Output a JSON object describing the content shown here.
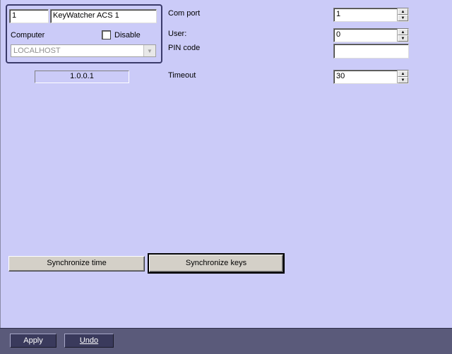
{
  "device": {
    "id": "1",
    "name": "KeyWatcher ACS 1",
    "computer_label": "Computer",
    "disable_label": "Disable",
    "computer_value": "LOCALHOST",
    "version": "1.0.0.1"
  },
  "settings": {
    "com_port_label": "Com port",
    "com_port_value": "1",
    "user_label": "User:",
    "user_value": "0",
    "pin_label": "PIN code",
    "pin_value": "",
    "timeout_label": "Timeout",
    "timeout_value": "30"
  },
  "actions": {
    "sync_time": "Synchronize time",
    "sync_keys": "Synchronize keys"
  },
  "footer": {
    "apply": "Apply",
    "undo": "Undo"
  }
}
